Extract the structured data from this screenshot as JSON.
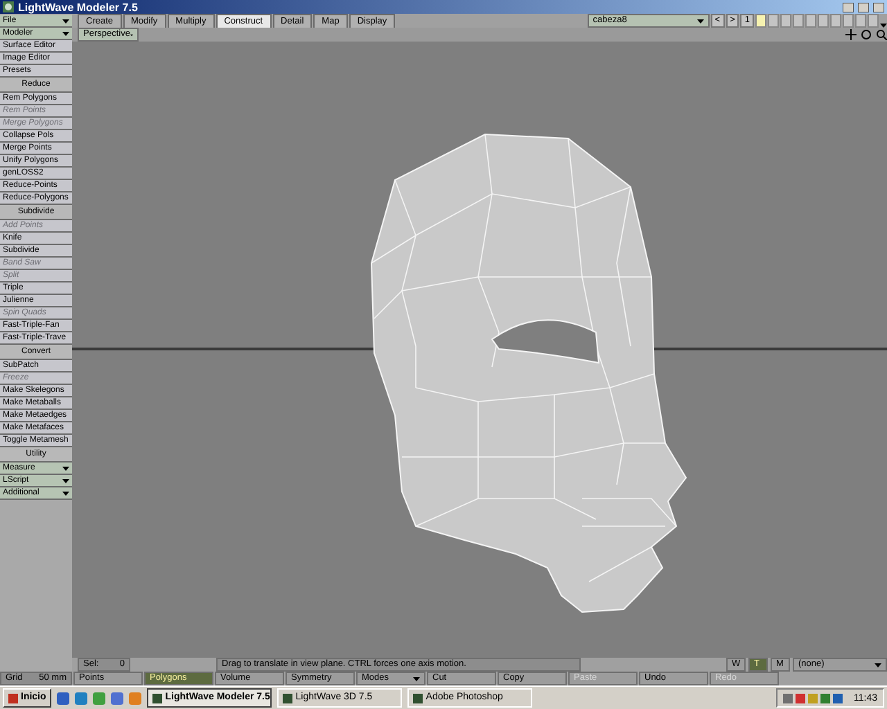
{
  "window": {
    "title": "LightWave Modeler 7.5"
  },
  "sidebar": {
    "items": [
      {
        "kind": "dropdown",
        "label": "File",
        "disabled": false
      },
      {
        "kind": "dropdown",
        "label": "Modeler",
        "disabled": false
      },
      {
        "kind": "button",
        "label": "Surface Editor",
        "disabled": false
      },
      {
        "kind": "button",
        "label": "Image Editor",
        "disabled": false
      },
      {
        "kind": "button",
        "label": "Presets",
        "disabled": false
      },
      {
        "kind": "section",
        "label": "Reduce",
        "disabled": false
      },
      {
        "kind": "button",
        "label": "Rem Polygons",
        "disabled": false
      },
      {
        "kind": "button",
        "label": "Rem Points",
        "disabled": true
      },
      {
        "kind": "button",
        "label": "Merge Polygons",
        "disabled": true
      },
      {
        "kind": "button",
        "label": "Collapse Pols",
        "disabled": false
      },
      {
        "kind": "button",
        "label": "Merge Points",
        "disabled": false
      },
      {
        "kind": "button",
        "label": "Unify Polygons",
        "disabled": false
      },
      {
        "kind": "button",
        "label": "genLOSS2",
        "disabled": false
      },
      {
        "kind": "button",
        "label": "Reduce-Points",
        "disabled": false
      },
      {
        "kind": "button",
        "label": "Reduce-Polygons",
        "disabled": false
      },
      {
        "kind": "section",
        "label": "Subdivide",
        "disabled": false
      },
      {
        "kind": "button",
        "label": "Add Points",
        "disabled": true
      },
      {
        "kind": "button",
        "label": "Knife",
        "disabled": false
      },
      {
        "kind": "button",
        "label": "Subdivide",
        "disabled": false
      },
      {
        "kind": "button",
        "label": "Band Saw",
        "disabled": true
      },
      {
        "kind": "button",
        "label": "Split",
        "disabled": true
      },
      {
        "kind": "button",
        "label": "Triple",
        "disabled": false
      },
      {
        "kind": "button",
        "label": "Julienne",
        "disabled": false
      },
      {
        "kind": "button",
        "label": "Spin Quads",
        "disabled": true
      },
      {
        "kind": "button",
        "label": "Fast-Triple-Fan",
        "disabled": false
      },
      {
        "kind": "button",
        "label": "Fast-Triple-Trave",
        "disabled": false
      },
      {
        "kind": "section",
        "label": "Convert",
        "disabled": false
      },
      {
        "kind": "button",
        "label": "SubPatch",
        "disabled": false
      },
      {
        "kind": "button",
        "label": "Freeze",
        "disabled": true
      },
      {
        "kind": "button",
        "label": "Make Skelegons",
        "disabled": false
      },
      {
        "kind": "button",
        "label": "Make Metaballs",
        "disabled": false
      },
      {
        "kind": "button",
        "label": "Make Metaedges",
        "disabled": false
      },
      {
        "kind": "button",
        "label": "Make Metafaces",
        "disabled": false
      },
      {
        "kind": "button",
        "label": "Toggle Metamesh",
        "disabled": false
      },
      {
        "kind": "section",
        "label": "Utility",
        "disabled": false
      },
      {
        "kind": "dropdown",
        "label": "Measure",
        "disabled": false
      },
      {
        "kind": "dropdown",
        "label": "LScript",
        "disabled": false
      },
      {
        "kind": "dropdown",
        "label": "Additional",
        "disabled": false
      }
    ]
  },
  "tabs": [
    {
      "label": "Create",
      "selected": false
    },
    {
      "label": "Modify",
      "selected": false
    },
    {
      "label": "Multiply",
      "selected": false
    },
    {
      "label": "Construct",
      "selected": true
    },
    {
      "label": "Detail",
      "selected": false
    },
    {
      "label": "Map",
      "selected": false
    },
    {
      "label": "Display",
      "selected": false
    }
  ],
  "object_selector": {
    "value": "cabeza8",
    "prev": "<",
    "next": ">",
    "layer": "1"
  },
  "viewport": {
    "view": "Perspective"
  },
  "status": {
    "sel_label": "Sel:",
    "sel_value": "0",
    "message": "Drag to translate in view plane. CTRL forces one axis motion."
  },
  "toolbar": {
    "grid_label": "Grid",
    "grid_value": "50 mm",
    "buttons": [
      {
        "kind": "button",
        "label": "Points",
        "selected": false,
        "disabled": false
      },
      {
        "kind": "button",
        "label": "Polygons",
        "selected": true,
        "disabled": false
      },
      {
        "kind": "button",
        "label": "Volume",
        "selected": false,
        "disabled": false
      },
      {
        "kind": "button",
        "label": "Symmetry",
        "selected": false,
        "disabled": false
      },
      {
        "kind": "dropdown",
        "label": "Modes",
        "selected": false,
        "disabled": false
      },
      {
        "kind": "button",
        "label": "Cut",
        "selected": false,
        "disabled": false
      },
      {
        "kind": "button",
        "label": "Copy",
        "selected": false,
        "disabled": false
      },
      {
        "kind": "button",
        "label": "Paste",
        "selected": false,
        "disabled": true
      },
      {
        "kind": "button",
        "label": "Undo",
        "selected": false,
        "disabled": false
      },
      {
        "kind": "button",
        "label": "Redo",
        "selected": false,
        "disabled": true
      }
    ],
    "map_modes": [
      {
        "label": "W",
        "selected": false
      },
      {
        "label": "T",
        "selected": true
      },
      {
        "label": "M",
        "selected": false
      }
    ],
    "map_value": "(none)"
  },
  "taskbar": {
    "start": "Inicio",
    "tasks": [
      {
        "label": "LightWave Modeler 7.5",
        "selected": true
      },
      {
        "label": "LightWave 3D 7.5",
        "selected": false
      },
      {
        "label": "Adobe Photoshop",
        "selected": false
      }
    ],
    "clock": "11:43"
  }
}
